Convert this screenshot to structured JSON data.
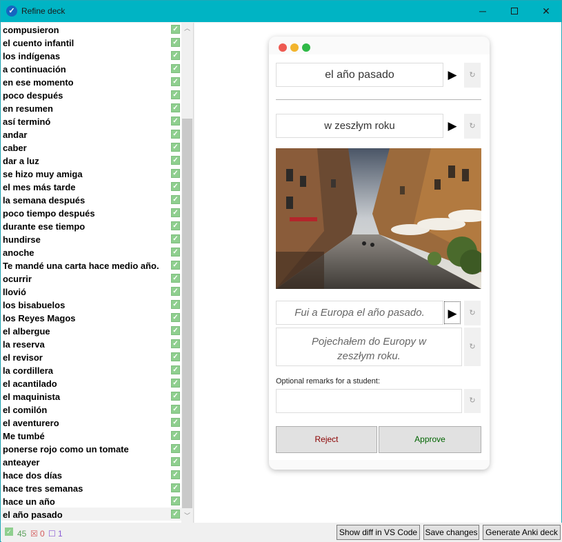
{
  "window": {
    "title": "Refine deck",
    "app_icon": "check-icon",
    "controls": {
      "minimize": "─",
      "close": "✕"
    }
  },
  "word_list": {
    "items": [
      "compusieron",
      "el cuento infantil",
      "los indígenas",
      "a continuación",
      "en ese momento",
      "poco después",
      "en resumen",
      "así terminó",
      "andar",
      "caber",
      "dar a luz",
      "se hizo muy amiga",
      "el mes más tarde",
      "la semana después",
      "poco tiempo después",
      "durante ese tiempo",
      "hundirse",
      "anoche",
      "Te mandé una carta hace medio año.",
      "ocurrir",
      "llovió",
      "los bisabuelos",
      "los Reyes Magos",
      "el albergue",
      "la reserva",
      "el revisor",
      "la cordillera",
      "el acantilado",
      "el maquinista",
      "el comilón",
      "el aventurero",
      "Me tumbé",
      "ponerse rojo como un tomate",
      "anteayer",
      "hace dos días",
      "hace tres semanas",
      "hace un año",
      "el año pasado"
    ],
    "check_mark": "✓",
    "selected_index": 37
  },
  "card": {
    "term": "el año pasado",
    "translation": "w zeszłym roku",
    "example": "Fui a Europa el año pasado.",
    "example_translation": "Pojechałem do Europy w zeszłym roku.",
    "remarks_label": "Optional remarks for a student:",
    "remarks_value": "",
    "play_icon": "▶",
    "refresh_icon": "↻",
    "image_alt": "street-photo",
    "reject_label": "Reject",
    "approve_label": "Approve",
    "reject_color": "#8b0000",
    "approve_color": "#006400"
  },
  "status": {
    "approved_icon": "✓",
    "approved_count": "45",
    "rejected_icon": "☒",
    "rejected_count": "0",
    "pending_icon": "☐",
    "pending_count": "1",
    "show_diff_label": "Show diff in VS Code",
    "save_label": "Save changes",
    "generate_label": "Generate Anki deck"
  }
}
